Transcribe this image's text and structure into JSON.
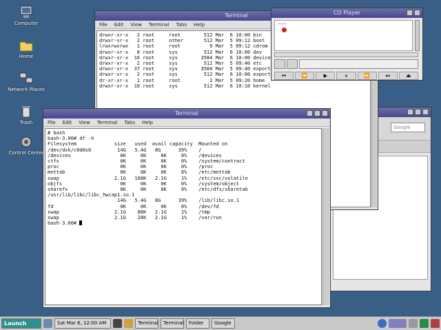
{
  "desktop": {
    "icons": [
      {
        "name": "computer-icon",
        "label": "Computer"
      },
      {
        "name": "folder-icon",
        "label": "Home"
      },
      {
        "name": "network-icon",
        "label": "Network Places"
      },
      {
        "name": "trash-icon",
        "label": "Trash"
      },
      {
        "name": "settings-icon",
        "label": "Control Center"
      }
    ]
  },
  "terminal_back": {
    "title": "Terminal",
    "menu": [
      "File",
      "Edit",
      "View",
      "Terminal",
      "Tabs",
      "Help"
    ],
    "lines": [
      "drwxr-xr-x   2 root     root        512 Mar  6 10:00 bin",
      "drwxr-xr-x   2 root     other       512 Mar  5 09:12 boot",
      "lrwxrwxrwx   1 root     root          9 Mar  5 09:12 cdrom",
      "drwxr-xr-x   8 root     sys         512 Mar  6 10:00 dev",
      "drwxr-xr-x  16 root     sys        3584 Mar  6 10:00 devices",
      "drwxr-xr-x   2 root     sys         512 Mar  5 09:40 etc",
      "drwxr-xr-x  37 root     sys        3584 Mar  5 09:40 export",
      "drwxr-xr-x   2 root     sys         512 Mar  6 10:00 export",
      "dr-xr-xr-x   1 root     root          1 Mar  5 09:20 home",
      "drwxr-xr-x  10 root     sys         512 Mar  6 10:10 kernel"
    ]
  },
  "cd_player": {
    "title": "CD Player",
    "time": "--:--"
  },
  "file_manager": {
    "search_placeholder": "Google"
  },
  "terminal_front": {
    "title": "Terminal",
    "menu": [
      "File",
      "Edit",
      "View",
      "Terminal",
      "Tabs",
      "Help"
    ],
    "lines": [
      "# bash",
      "bash-3.00# df -h",
      "Filesystem             size   used  avail capacity  Mounted on",
      "/dev/dsk/c0d0s0         14G   5.4G   8G      39%    /",
      "/devices                 0K     0K     0K     0%    /devices",
      "ctfs                     0K     0K     0K     0%    /system/contract",
      "proc                     0K     0K     0K     0%    /proc",
      "mnttab                   0K     0K     0K     0%    /etc/mnttab",
      "swap                   2.1G   108K   2.1G     1%    /etc/svc/volatile",
      "objfs                    0K     0K     0K     0%    /system/object",
      "sharefs                  0K     0K     0K     0%    /etc/dfs/sharetab",
      "/usr/lib/libc/libc_hwcap1.so.1",
      "                        14G   5.4G   8G      39%    /lib/libc.so.1",
      "fd                       0K     0K     0K     0%    /dev/fd",
      "swap                   2.1G    88K   2.1G     1%    /tmp",
      "swap                   2.1G    28K   2.1G     1%    /var/run",
      "bash-3.00# "
    ]
  },
  "taskbar": {
    "start_label": "Launch",
    "clock": "Sat Mar 6, 12:00 AM",
    "tasks": [
      "Terminal",
      "Terminal",
      "Folder",
      "Google"
    ]
  }
}
